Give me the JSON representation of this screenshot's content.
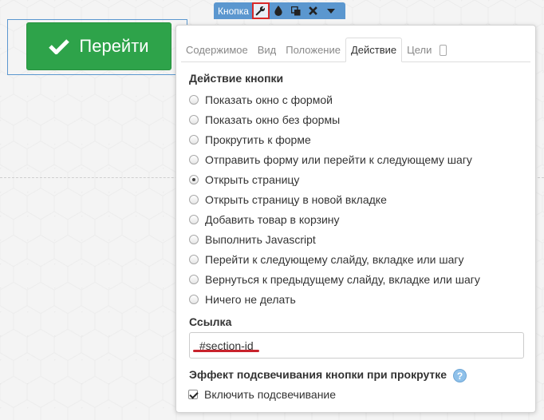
{
  "toolbar": {
    "label": "Кнопка",
    "icons": [
      "wrench-icon",
      "drop-icon",
      "copy-icon",
      "close-icon",
      "caret-down-icon"
    ]
  },
  "canvas_button": {
    "label": "Перейти",
    "icon": "checkmark-icon",
    "color": "#2ea34a"
  },
  "panel": {
    "tabs": [
      {
        "label": "Содержимое",
        "active": false
      },
      {
        "label": "Вид",
        "active": false
      },
      {
        "label": "Положение",
        "active": false
      },
      {
        "label": "Действие",
        "active": true
      },
      {
        "label": "Цели",
        "active": false
      }
    ],
    "action_title": "Действие кнопки",
    "actions": [
      {
        "label": "Показать окно с формой",
        "checked": false
      },
      {
        "label": "Показать окно без формы",
        "checked": false
      },
      {
        "label": "Прокрутить к форме",
        "checked": false
      },
      {
        "label": "Отправить форму или перейти к следующему шагу",
        "checked": false
      },
      {
        "label": "Открыть страницу",
        "checked": true
      },
      {
        "label": "Открыть страницу в новой вкладке",
        "checked": false
      },
      {
        "label": "Добавить товар в корзину",
        "checked": false
      },
      {
        "label": "Выполнить Javascript",
        "checked": false
      },
      {
        "label": "Перейти к следующему слайду, вкладке или шагу",
        "checked": false
      },
      {
        "label": "Вернуться к предыдущему слайду, вкладке или шагу",
        "checked": false
      },
      {
        "label": "Ничего не делать",
        "checked": false
      }
    ],
    "link_title": "Ссылка",
    "link_value": "#section-id",
    "highlight_title": "Эффект подсвечивания кнопки при прокрутке",
    "help_glyph": "?",
    "highlight_checkbox_label": "Включить подсвечивание",
    "highlight_checked": true
  }
}
